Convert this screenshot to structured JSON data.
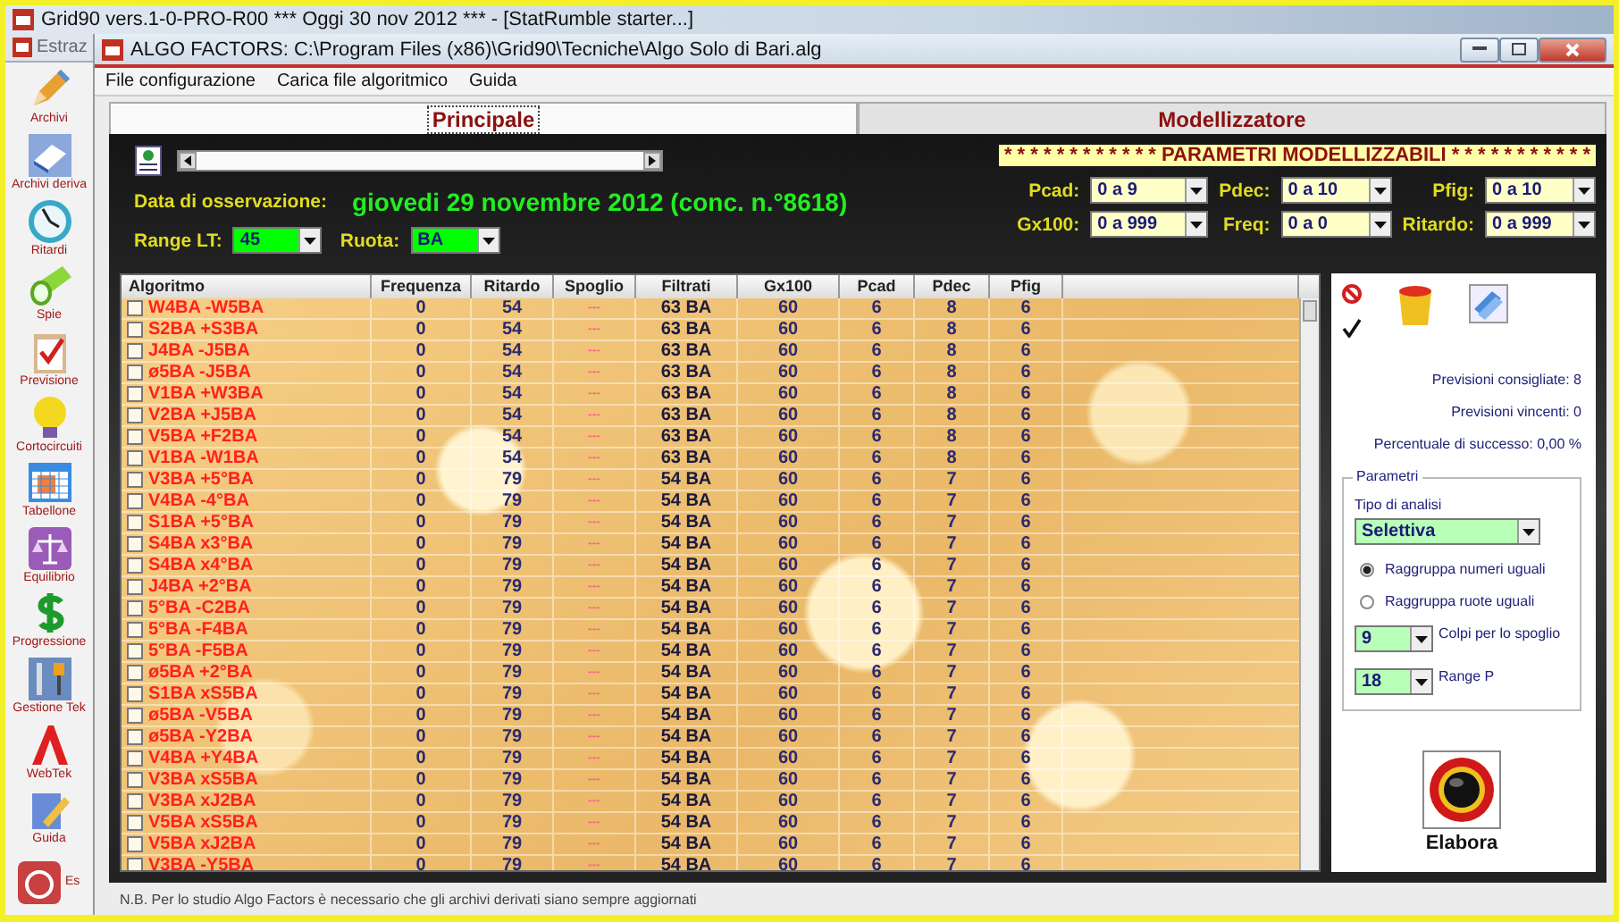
{
  "back_window": {
    "title": "Grid90 vers.1-0-PRO-R00  ***  Oggi 30 nov 2012  ***   - [StatRumble starter...]",
    "tab": "Estraz"
  },
  "sidebar": {
    "items": [
      {
        "kind": "pencil",
        "label": "Archivi",
        "inline": false
      },
      {
        "kind": "book",
        "label": "Archivi deriva",
        "inline": false
      },
      {
        "kind": "clock",
        "label": "Ritardi",
        "inline": false
      },
      {
        "kind": "flashlight",
        "label": "Spie",
        "inline": false
      },
      {
        "kind": "clipboard",
        "label": "Previsione",
        "inline": false
      },
      {
        "kind": "bulb",
        "label": "Cortocircuiti",
        "inline": false
      },
      {
        "kind": "grid",
        "label": "Tabellone",
        "inline": false
      },
      {
        "kind": "scales",
        "label": "Equilibrio",
        "inline": false
      },
      {
        "kind": "dollar",
        "label": "Progressione",
        "inline": false
      },
      {
        "kind": "tools",
        "label": "Gestione Tek",
        "inline": false
      },
      {
        "kind": "arch",
        "label": "WebTek",
        "inline": false
      },
      {
        "kind": "pen",
        "label": "Guida",
        "inline": false
      },
      {
        "kind": "power",
        "label": "Es",
        "inline": true
      }
    ]
  },
  "window": {
    "title": "ALGO FACTORS: C:\\Program Files (x86)\\Grid90\\Tecniche\\Algo Solo di Bari.alg"
  },
  "menu": [
    "File configurazione",
    "Carica file algoritmico",
    "Guida"
  ],
  "tabs": [
    {
      "label": "Principale",
      "selected": true
    },
    {
      "label": "Modellizzatore",
      "selected": false
    }
  ],
  "observation": {
    "label": "Data di osservazione:",
    "date": "giovedi 29 novembre 2012 (conc. n.°8618)"
  },
  "filters": [
    {
      "label": "Range LT:",
      "value": "45"
    },
    {
      "label": "Ruota:",
      "value": "BA"
    }
  ],
  "banner": "* * * * * * * * * * * * PARAMETRI MODELLIZZABILI * * * * * * * * * * *",
  "parameters": [
    {
      "label": "Pcad:",
      "value": "0 a 9"
    },
    {
      "label": "Pdec:",
      "value": "0 a 10"
    },
    {
      "label": "Pfig:",
      "value": "0 a 10"
    },
    {
      "label": "Gx100:",
      "value": "0 a 999"
    },
    {
      "label": "Freq:",
      "value": "0 a 0"
    },
    {
      "label": "Ritardo:",
      "value": "0 a 999"
    }
  ],
  "table": {
    "columns": [
      "Algoritmo",
      "Frequenza",
      "Ritardo",
      "Spoglio",
      "Filtrati",
      "Gx100",
      "Pcad",
      "Pdec",
      "Pfig"
    ],
    "rows": [
      {
        "checked": false,
        "cells": [
          "W4BA -W5BA",
          "0",
          "54",
          "---",
          "63 BA",
          "60",
          "6",
          "8",
          "6"
        ]
      },
      {
        "checked": false,
        "cells": [
          "S2BA +S3BA",
          "0",
          "54",
          "---",
          "63 BA",
          "60",
          "6",
          "8",
          "6"
        ]
      },
      {
        "checked": false,
        "cells": [
          "J4BA -J5BA",
          "0",
          "54",
          "---",
          "63 BA",
          "60",
          "6",
          "8",
          "6"
        ]
      },
      {
        "checked": false,
        "cells": [
          "ø5BA -J5BA",
          "0",
          "54",
          "---",
          "63 BA",
          "60",
          "6",
          "8",
          "6"
        ]
      },
      {
        "checked": false,
        "cells": [
          "V1BA +W3BA",
          "0",
          "54",
          "---",
          "63 BA",
          "60",
          "6",
          "8",
          "6"
        ]
      },
      {
        "checked": false,
        "cells": [
          "V2BA +J5BA",
          "0",
          "54",
          "---",
          "63 BA",
          "60",
          "6",
          "8",
          "6"
        ]
      },
      {
        "checked": false,
        "cells": [
          "V5BA +F2BA",
          "0",
          "54",
          "---",
          "63 BA",
          "60",
          "6",
          "8",
          "6"
        ]
      },
      {
        "checked": false,
        "cells": [
          "V1BA -W1BA",
          "0",
          "54",
          "---",
          "63 BA",
          "60",
          "6",
          "8",
          "6"
        ]
      },
      {
        "checked": false,
        "cells": [
          "V3BA +5°BA",
          "0",
          "79",
          "---",
          "54 BA",
          "60",
          "6",
          "7",
          "6"
        ]
      },
      {
        "checked": false,
        "cells": [
          "V4BA -4°BA",
          "0",
          "79",
          "---",
          "54 BA",
          "60",
          "6",
          "7",
          "6"
        ]
      },
      {
        "checked": false,
        "cells": [
          "S1BA +5°BA",
          "0",
          "79",
          "---",
          "54 BA",
          "60",
          "6",
          "7",
          "6"
        ]
      },
      {
        "checked": false,
        "cells": [
          "S4BA x3°BA",
          "0",
          "79",
          "---",
          "54 BA",
          "60",
          "6",
          "7",
          "6"
        ]
      },
      {
        "checked": false,
        "cells": [
          "S4BA x4°BA",
          "0",
          "79",
          "---",
          "54 BA",
          "60",
          "6",
          "7",
          "6"
        ]
      },
      {
        "checked": false,
        "cells": [
          "J4BA +2°BA",
          "0",
          "79",
          "---",
          "54 BA",
          "60",
          "6",
          "7",
          "6"
        ]
      },
      {
        "checked": false,
        "cells": [
          "5°BA -C2BA",
          "0",
          "79",
          "---",
          "54 BA",
          "60",
          "6",
          "7",
          "6"
        ]
      },
      {
        "checked": false,
        "cells": [
          "5°BA -F4BA",
          "0",
          "79",
          "---",
          "54 BA",
          "60",
          "6",
          "7",
          "6"
        ]
      },
      {
        "checked": false,
        "cells": [
          "5°BA -F5BA",
          "0",
          "79",
          "---",
          "54 BA",
          "60",
          "6",
          "7",
          "6"
        ]
      },
      {
        "checked": false,
        "cells": [
          "ø5BA +2°BA",
          "0",
          "79",
          "---",
          "54 BA",
          "60",
          "6",
          "7",
          "6"
        ]
      },
      {
        "checked": false,
        "cells": [
          "S1BA xS5BA",
          "0",
          "79",
          "---",
          "54 BA",
          "60",
          "6",
          "7",
          "6"
        ]
      },
      {
        "checked": false,
        "cells": [
          "ø5BA -V5BA",
          "0",
          "79",
          "---",
          "54 BA",
          "60",
          "6",
          "7",
          "6"
        ]
      },
      {
        "checked": false,
        "cells": [
          "ø5BA -Y2BA",
          "0",
          "79",
          "---",
          "54 BA",
          "60",
          "6",
          "7",
          "6"
        ]
      },
      {
        "checked": false,
        "cells": [
          "V4BA +Y4BA",
          "0",
          "79",
          "---",
          "54 BA",
          "60",
          "6",
          "7",
          "6"
        ]
      },
      {
        "checked": false,
        "cells": [
          "V3BA xS5BA",
          "0",
          "79",
          "---",
          "54 BA",
          "60",
          "6",
          "7",
          "6"
        ]
      },
      {
        "checked": false,
        "cells": [
          "V3BA xJ2BA",
          "0",
          "79",
          "---",
          "54 BA",
          "60",
          "6",
          "7",
          "6"
        ]
      },
      {
        "checked": false,
        "cells": [
          "V5BA xS5BA",
          "0",
          "79",
          "---",
          "54 BA",
          "60",
          "6",
          "7",
          "6"
        ]
      },
      {
        "checked": false,
        "cells": [
          "V5BA xJ2BA",
          "0",
          "79",
          "---",
          "54 BA",
          "60",
          "6",
          "7",
          "6"
        ]
      },
      {
        "checked": false,
        "cells": [
          "V3BA -Y5BA",
          "0",
          "79",
          "---",
          "54 BA",
          "60",
          "6",
          "7",
          "6"
        ]
      }
    ]
  },
  "stats": [
    "Previsioni consigliate: 8",
    "Previsioni vincenti: 0",
    "Percentuale di successo: 0,00 %"
  ],
  "parametri": {
    "title": "Parametri",
    "analysis_label": "Tipo di analisi",
    "analysis_value": "Selettiva",
    "options": [
      {
        "label": "Raggruppa numeri uguali",
        "selected": true
      },
      {
        "label": "Raggruppa ruote uguali",
        "selected": false
      }
    ],
    "selects": [
      {
        "value": "9",
        "label": "Colpi per lo spoglio"
      },
      {
        "value": "18",
        "label": "Range P"
      }
    ]
  },
  "action": {
    "label": "Elabora"
  },
  "note": "N.B. Per lo studio Algo Factors è necessario che gli archivi derivati siano sempre aggiornati"
}
